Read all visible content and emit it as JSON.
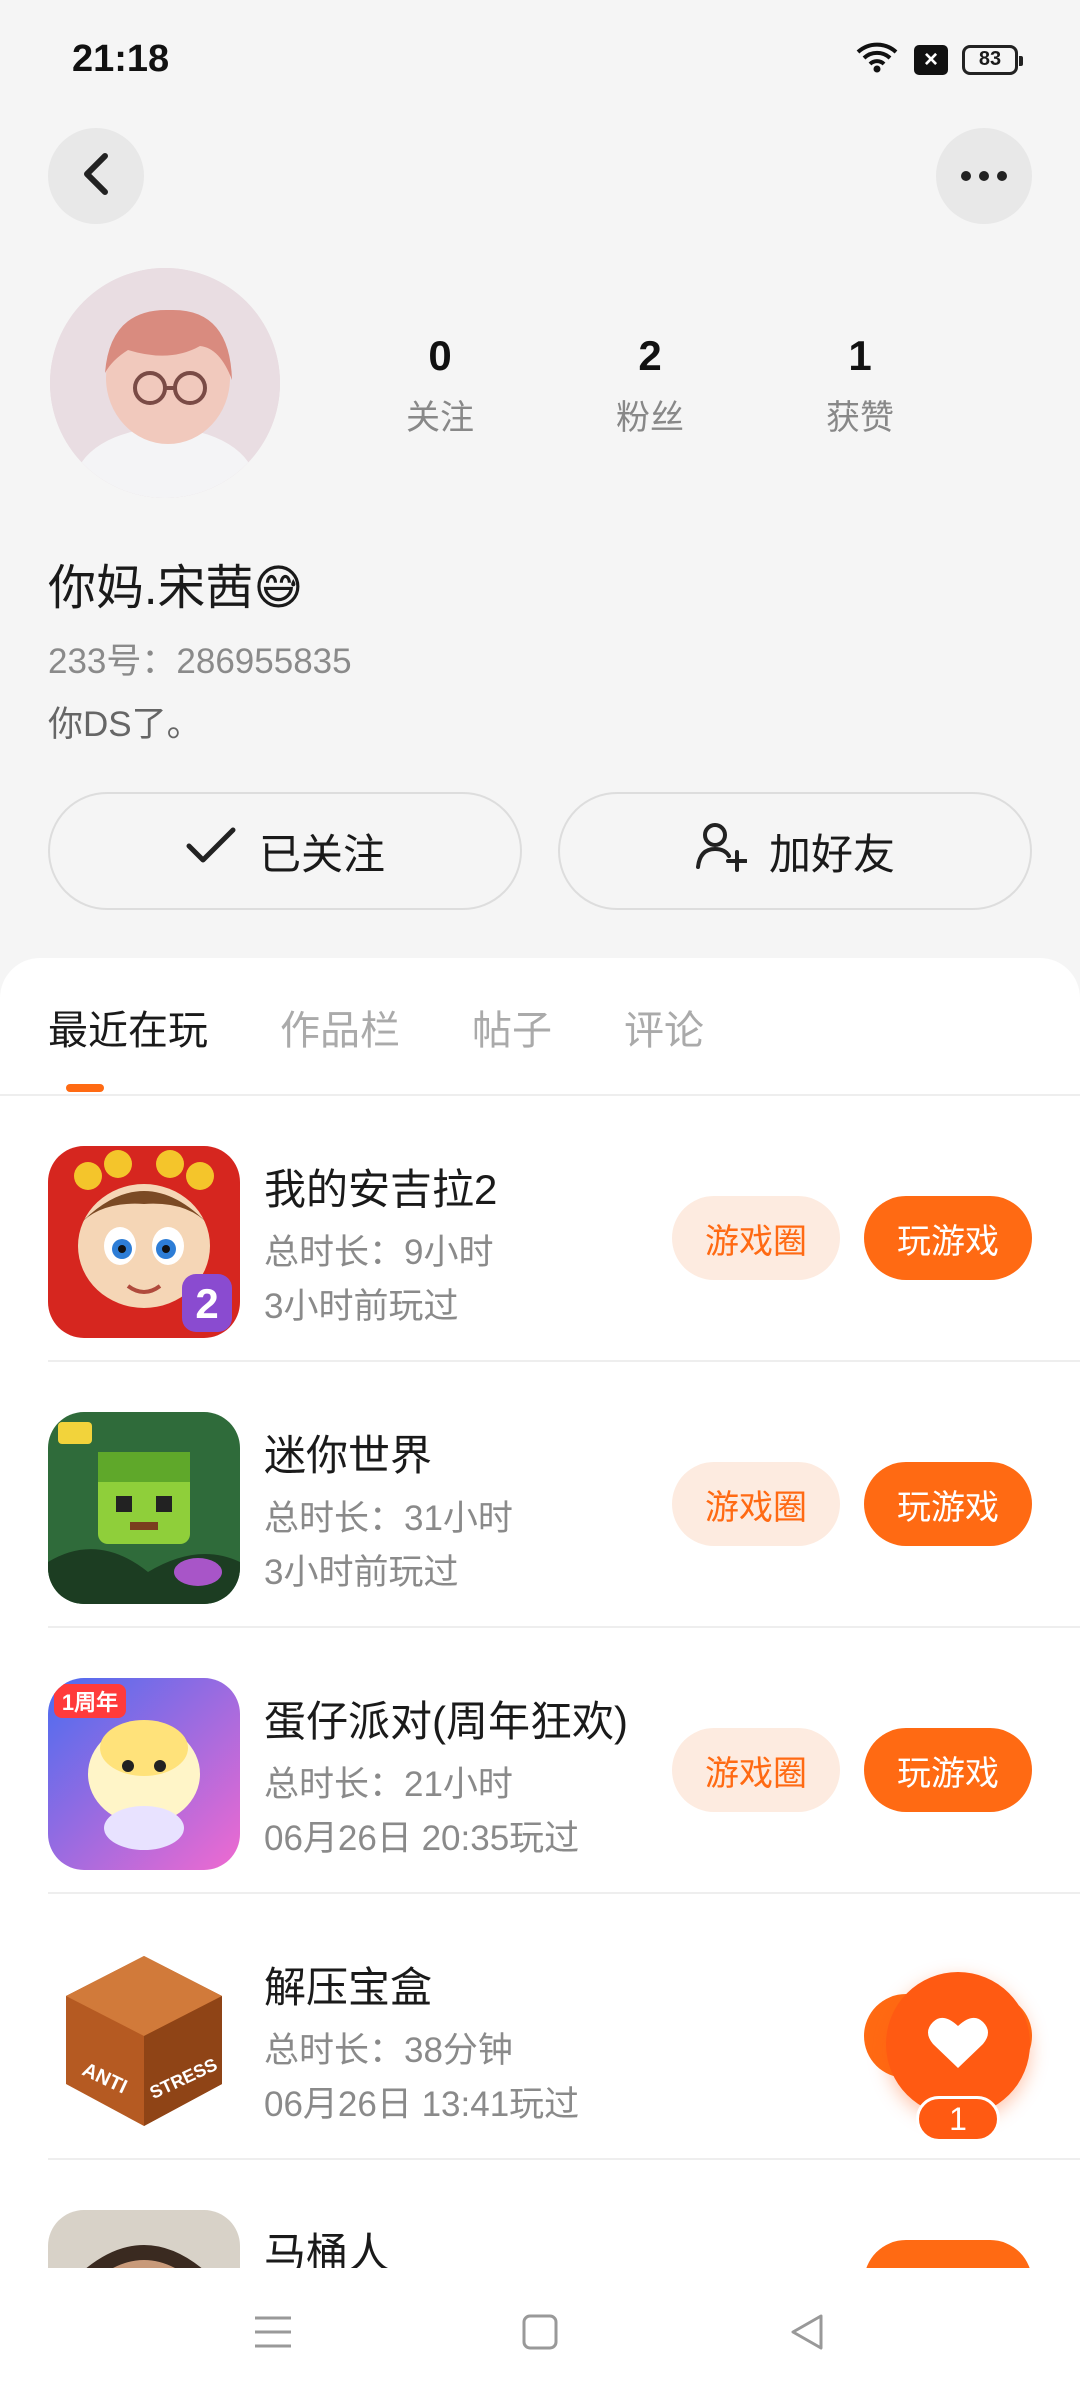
{
  "status_bar": {
    "time": "21:18",
    "battery": "83",
    "icons": [
      "wifi-icon",
      "close-box-icon",
      "battery-icon"
    ]
  },
  "header": {
    "back_icon": "chevron-left-icon",
    "more_icon": "more-dots-icon"
  },
  "profile": {
    "username": "你妈.宋茜😅",
    "account_id": "233号：286955835",
    "bio": "你DS了。",
    "stats": [
      {
        "value": "0",
        "label": "关注"
      },
      {
        "value": "2",
        "label": "粉丝"
      },
      {
        "value": "1",
        "label": "获赞"
      }
    ]
  },
  "actions": {
    "followed_label": "已关注",
    "add_friend_label": "加好友"
  },
  "tabs": [
    {
      "label": "最近在玩",
      "active": true
    },
    {
      "label": "作品栏",
      "active": false
    },
    {
      "label": "帖子",
      "active": false
    },
    {
      "label": "评论",
      "active": false
    }
  ],
  "game_buttons": {
    "circle": "游戏圈",
    "play": "玩游戏"
  },
  "games": [
    {
      "name": "我的安吉拉2",
      "duration": "总时长：9小时",
      "last_played": "3小时前玩过"
    },
    {
      "name": "迷你世界",
      "duration": "总时长：31小时",
      "last_played": "3小时前玩过"
    },
    {
      "name": "蛋仔派对(周年狂欢)",
      "duration": "总时长：21小时",
      "last_played": "06月26日 20:35玩过"
    },
    {
      "name": "解压宝盒",
      "duration": "总时长：38分钟",
      "last_played": "06月26日 13:41玩过"
    },
    {
      "name": "马桶人",
      "duration": "",
      "last_played": ""
    }
  ],
  "icon_text": {
    "angela_badge": "2",
    "anniversary_badge": "1周年",
    "antistress_left": "ANTI",
    "antistress_right": "STRESS"
  },
  "fab": {
    "count": "1",
    "icon": "heart-icon"
  },
  "colors": {
    "accent": "#ff6a13",
    "accent_light": "#fdebe0"
  }
}
